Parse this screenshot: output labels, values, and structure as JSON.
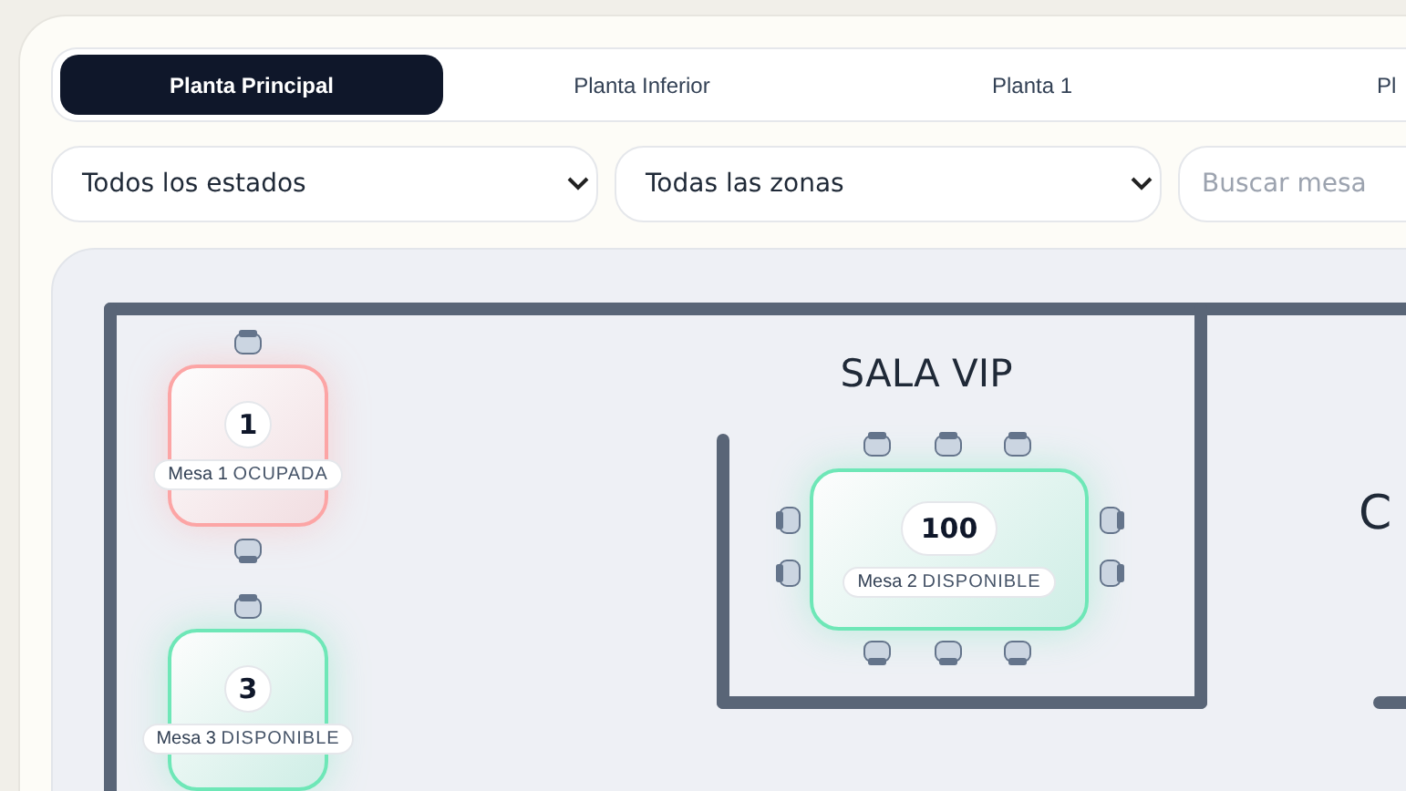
{
  "tabs": [
    {
      "label": "Planta Principal",
      "selected": true
    },
    {
      "label": "Planta Inferior",
      "selected": false
    },
    {
      "label": "Planta 1",
      "selected": false
    },
    {
      "label": "Pl",
      "selected": false
    }
  ],
  "filters": {
    "status_select": "Todos los estados",
    "zone_select": "Todas las zonas",
    "search": {
      "placeholder": "Buscar mesa"
    }
  },
  "floor_plan": {
    "zones": [
      {
        "label": "SALA VIP"
      },
      {
        "label": "C"
      }
    ],
    "tables": [
      {
        "number": "1",
        "name": "Mesa 1",
        "status": "OCUPADA",
        "kind": "square",
        "color": "#fca5a5"
      },
      {
        "number": "100",
        "name": "Mesa 2",
        "status": "DISPONIBLE",
        "kind": "rect",
        "color": "#6ee7b7"
      },
      {
        "number": "3",
        "name": "Mesa 3",
        "status": "DISPONIBLE",
        "kind": "square",
        "color": "#6ee7b7"
      }
    ]
  }
}
